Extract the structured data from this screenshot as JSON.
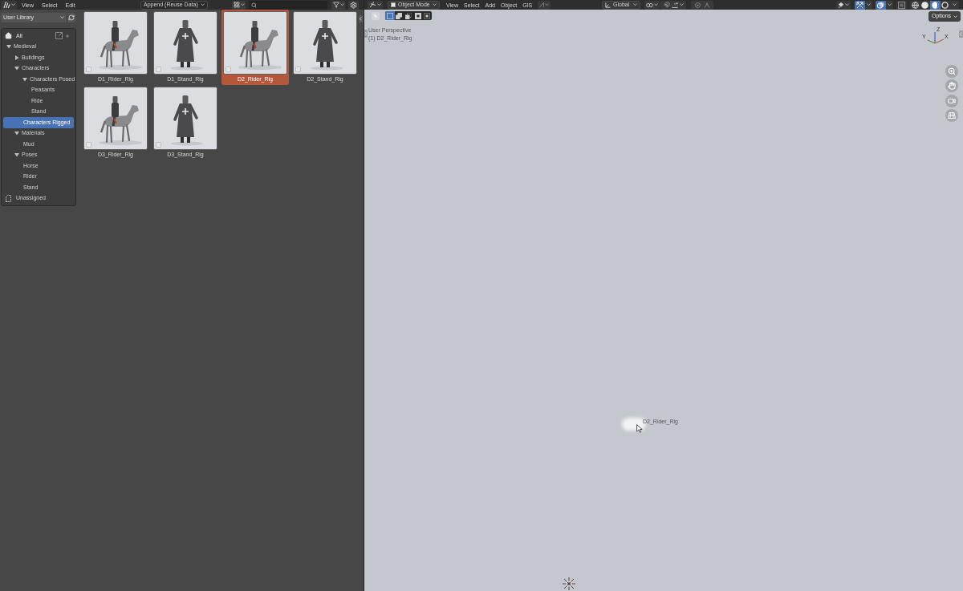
{
  "file_browser": {
    "header": {
      "menus": [
        "View",
        "Select",
        "Edit"
      ],
      "import_method": "Append (Reuse Data)"
    },
    "sidebar": {
      "library": "User Library",
      "all": {
        "label": "All",
        "selected": false
      },
      "tree": [
        {
          "label": "Medieval",
          "expanded": true,
          "selected": false,
          "children": [
            {
              "label": "Buildings",
              "expanded": false,
              "selected": false
            },
            {
              "label": "Characters",
              "expanded": true,
              "selected": false,
              "children": [
                {
                  "label": "Characters Posed",
                  "expanded": true,
                  "selected": false,
                  "children": [
                    {
                      "label": "Peasants",
                      "selected": false
                    },
                    {
                      "label": "Ride",
                      "selected": false
                    },
                    {
                      "label": "Stand",
                      "selected": false
                    }
                  ]
                },
                {
                  "label": "Characters Rigged",
                  "selected": true
                }
              ]
            },
            {
              "label": "Materials",
              "expanded": true,
              "selected": false,
              "children": [
                {
                  "label": "Mud",
                  "selected": false
                }
              ]
            },
            {
              "label": "Poses",
              "expanded": true,
              "selected": false,
              "children": [
                {
                  "label": "Horse",
                  "selected": false
                },
                {
                  "label": "Rider",
                  "selected": false
                },
                {
                  "label": "Stand",
                  "selected": false
                }
              ]
            }
          ]
        }
      ],
      "unassigned": {
        "label": "Unassigned",
        "selected": false
      }
    },
    "assets": [
      {
        "name": "D1_Rider_Rig",
        "kind": "rider",
        "selected": false,
        "checked": false
      },
      {
        "name": "D1_Stand_Rig",
        "kind": "standing",
        "selected": false,
        "checked": false
      },
      {
        "name": "D2_Rider_Rig",
        "kind": "rider",
        "selected": true,
        "checked": false
      },
      {
        "name": "D2_Stand_Rig",
        "kind": "standing",
        "selected": false,
        "checked": false
      },
      {
        "name": "D3_Rider_Rig",
        "kind": "rider",
        "selected": false,
        "checked": false
      },
      {
        "name": "D3_Stand_Rig",
        "kind": "standing",
        "selected": false,
        "checked": false
      }
    ]
  },
  "viewport": {
    "header": {
      "mode": "Object Mode",
      "menus": [
        "View",
        "Select",
        "Add",
        "Object",
        "GIS"
      ],
      "orientation": "Global",
      "toggles": [
        {
          "kind": "gizmo",
          "on": true
        },
        {
          "kind": "overlays",
          "on": true
        },
        {
          "kind": "xray",
          "on": false
        }
      ],
      "shading_modes": [
        {
          "kind": "wireframe",
          "selected": false
        },
        {
          "kind": "solid",
          "selected": false
        },
        {
          "kind": "material",
          "selected": true
        },
        {
          "kind": "rendered",
          "selected": false
        }
      ]
    },
    "select_modes": [
      {
        "kind": "set",
        "selected": true
      },
      {
        "kind": "extend",
        "selected": false
      },
      {
        "kind": "subtract",
        "selected": false
      },
      {
        "kind": "invert",
        "selected": false
      },
      {
        "kind": "intersect",
        "selected": false
      }
    ],
    "view_name": "User Perspective",
    "active_object": "(1) D2_Rider_Rig",
    "options_button": "Options",
    "gizmo_axes": {
      "z": "Z",
      "y": "Y",
      "x": "X"
    },
    "object_label": "D2_Rider_Rig"
  }
}
